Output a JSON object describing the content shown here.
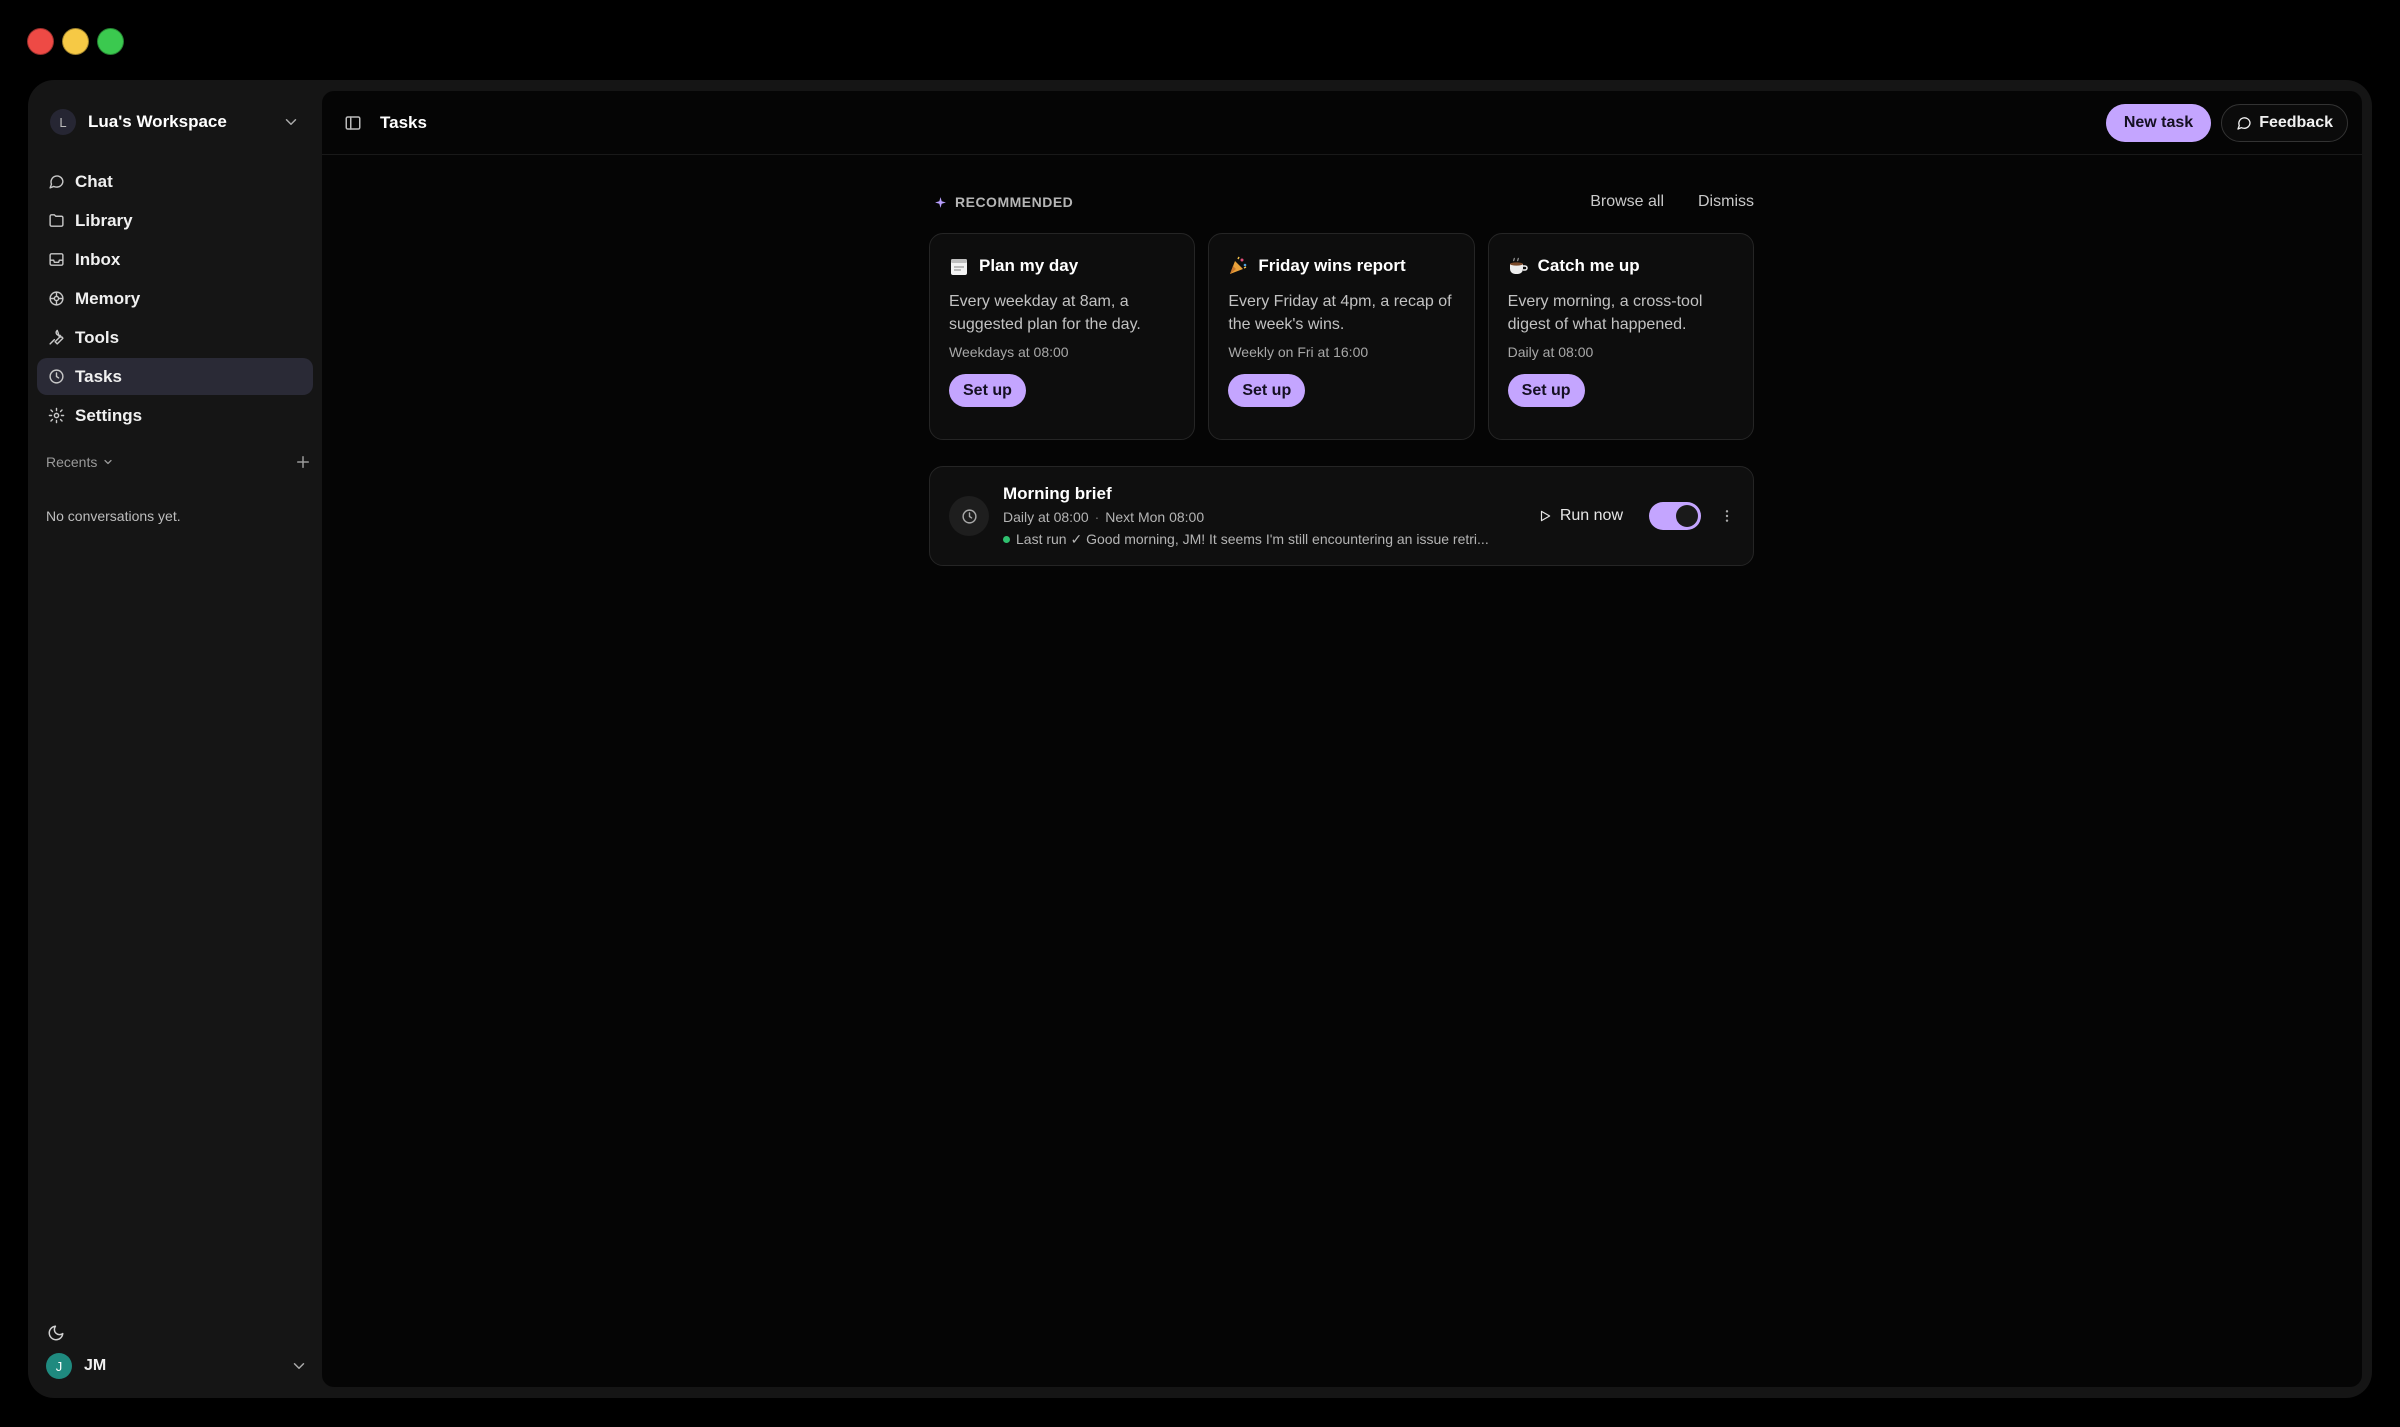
{
  "workspace": {
    "avatar_letter": "L",
    "name": "Lua's Workspace"
  },
  "nav": [
    {
      "label": "Chat",
      "icon": "chat-icon",
      "active": false
    },
    {
      "label": "Library",
      "icon": "folder-icon",
      "active": false
    },
    {
      "label": "Inbox",
      "icon": "inbox-icon",
      "active": false
    },
    {
      "label": "Memory",
      "icon": "brain-icon",
      "active": false
    },
    {
      "label": "Tools",
      "icon": "tool-icon",
      "active": false
    },
    {
      "label": "Tasks",
      "icon": "clock-icon",
      "active": true
    },
    {
      "label": "Settings",
      "icon": "gear-icon",
      "active": false
    }
  ],
  "recents": {
    "label": "Recents",
    "empty": "No conversations yet."
  },
  "user": {
    "avatar_letter": "J",
    "name": "JM",
    "avatar_color": "#1f8a7f"
  },
  "header": {
    "title": "Tasks",
    "new_task": "New task",
    "feedback": "Feedback"
  },
  "recommended": {
    "label": "RECOMMENDED",
    "browse_all": "Browse all",
    "dismiss": "Dismiss",
    "cards": [
      {
        "emoji": "notepad",
        "title": "Plan my day",
        "description": "Every weekday at 8am, a suggested plan for the day.",
        "schedule": "Weekdays at 08:00",
        "button": "Set up"
      },
      {
        "emoji": "party-popper",
        "title": "Friday wins report",
        "description": "Every Friday at 4pm, a recap of the week's wins.",
        "schedule": "Weekly on Fri at 16:00",
        "button": "Set up"
      },
      {
        "emoji": "coffee",
        "title": "Catch me up",
        "description": "Every morning, a cross-tool digest of what happened.",
        "schedule": "Daily at 08:00",
        "button": "Set up"
      }
    ]
  },
  "task": {
    "title": "Morning brief",
    "schedule": "Daily at 08:00",
    "next": "Next Mon 08:00",
    "last_run": "Last run ✓ Good morning, JM! It seems I'm still encountering an issue retri...",
    "run_now": "Run now",
    "enabled": true
  },
  "colors": {
    "accent": "#c4a5ff",
    "background": "#000000",
    "surface": "#151515",
    "success": "#2fc06f"
  }
}
